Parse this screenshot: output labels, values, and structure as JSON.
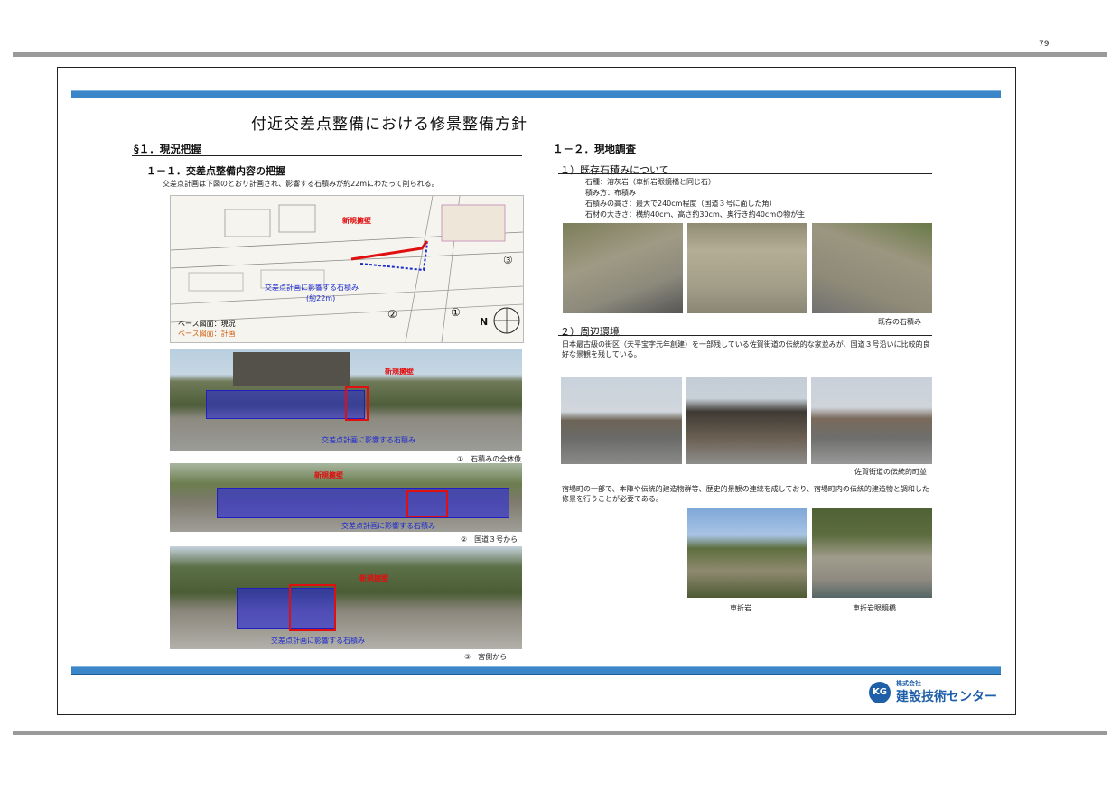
{
  "page_number": "79",
  "title": "付近交差点整備における修景整備方針",
  "left": {
    "section": "§１．現況把握",
    "sub1": "１－１．交差点整備内容の把握",
    "sub1_text": "交差点計画は下図のとおり計画され、影響する石積みが約22mにわたって削られる。",
    "map_labels": {
      "new_wall": "新規擁壁",
      "affected": "交差点計画に影響する石積み",
      "length": "(約22m)",
      "base_current": "ベース図面：現況",
      "base_plan": "ベース図面：計画",
      "n1": "①",
      "n2": "②",
      "n3": "③",
      "north": "N"
    },
    "photo1_labels": {
      "new_wall": "新規擁壁",
      "affected": "交差点計画に影響する石積み",
      "caption": "①　石積みの全体像"
    },
    "photo2_labels": {
      "new_wall": "新規擁壁",
      "affected": "交差点計画に影響する石積み",
      "caption": "②　国道３号から"
    },
    "photo3_labels": {
      "new_wall": "新規擁壁",
      "affected": "交差点計画に影響する石積み",
      "caption": "③　宮側から"
    }
  },
  "right": {
    "section": "１－２．現地調査",
    "sub1": "１）既存石積みについて",
    "stone_lines": [
      "石種：溶灰岩（車折岩眼鏡橋と同じ石）",
      "積み方：布積み",
      "石積みの高さ：最大で240cm程度（国道３号に面した角）",
      "石材の大きさ：横約40cm、高さ約30cm、奥行き約40cmの物が主"
    ],
    "photo_caption1": "既存の石積み",
    "sub2": "２）周辺環境",
    "env_text": "日本最古級の街区（天平宝字元年創建）を一部残している佐賀街道の伝統的な家並みが、国道３号沿いに比較的良好な景観を残している。",
    "photo_caption2": "佐賀街道の伝統的町並",
    "env_text2": "宿場町の一部で、本陣や伝統的建造物群等、歴史的景観の連続を成しており、宿場町内の伝統的建造物と調和した修景を行うことが必要である。",
    "photo_caption3": "車折岩",
    "photo_caption4": "車折岩眼鏡橋"
  },
  "logo": {
    "mark": "KG",
    "company_small": "株式会社",
    "company": "建設技術センター"
  }
}
